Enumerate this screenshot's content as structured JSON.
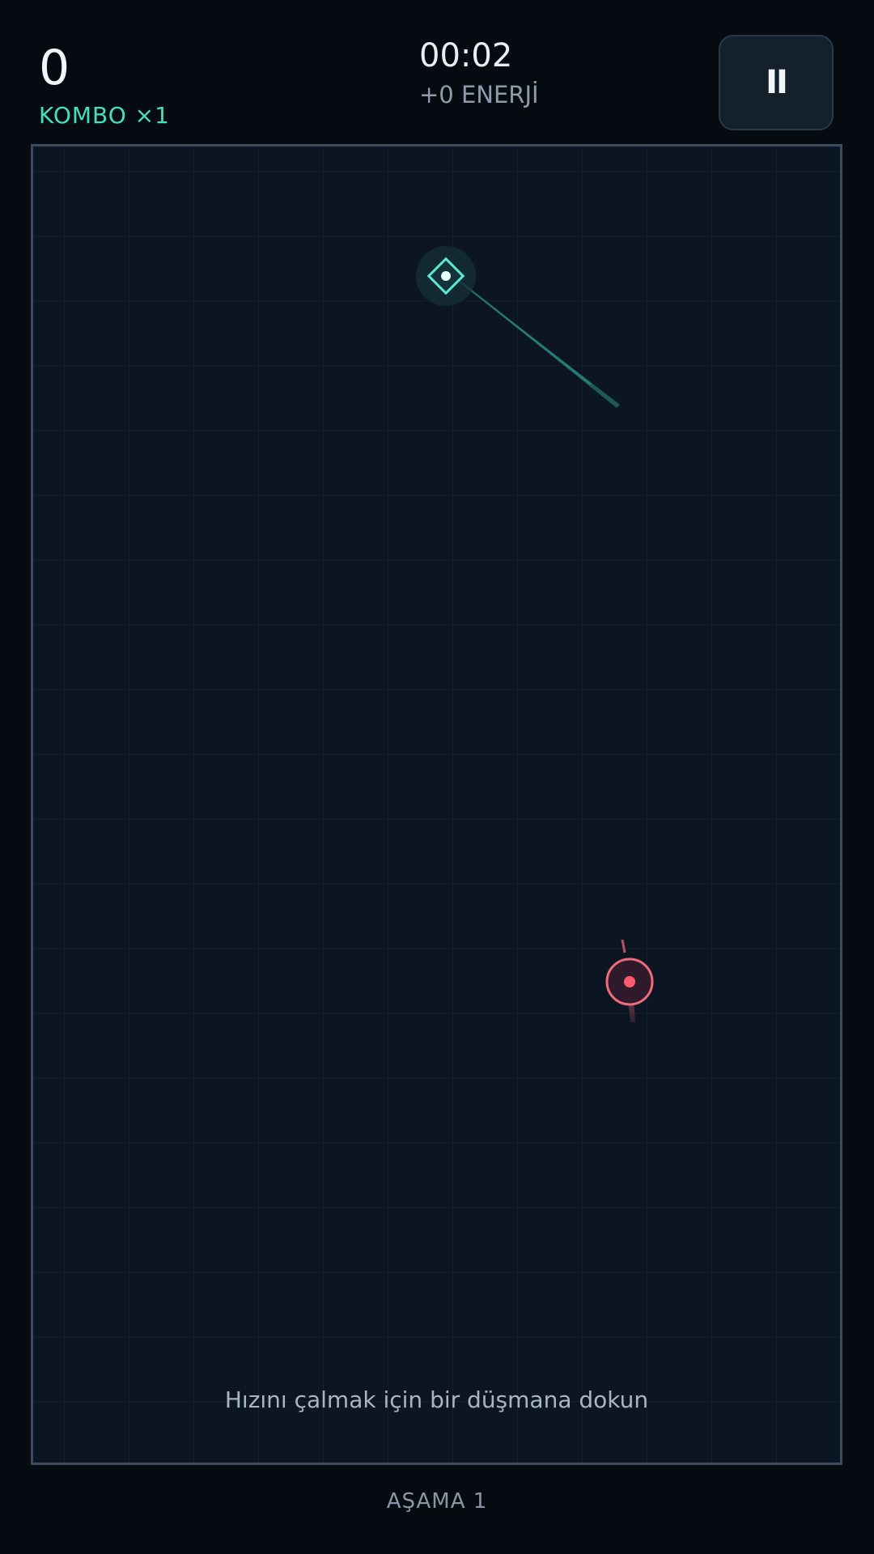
{
  "hud": {
    "score": "0",
    "combo": "KOMBO ×1",
    "timer": "00:02",
    "energy": "+0 ENERJİ",
    "pause_glyph": "II",
    "pause_icon": "pause-icon"
  },
  "arena": {
    "hint": "Hızını çalmak için bir düşmana dokun"
  },
  "footer": {
    "stage": "AŞAMA 1"
  },
  "colors": {
    "player": "#5ee8d0",
    "enemy": "#f06b7a",
    "combo": "#46e0b8",
    "background": "#060b12",
    "arena": "#0c1623"
  }
}
